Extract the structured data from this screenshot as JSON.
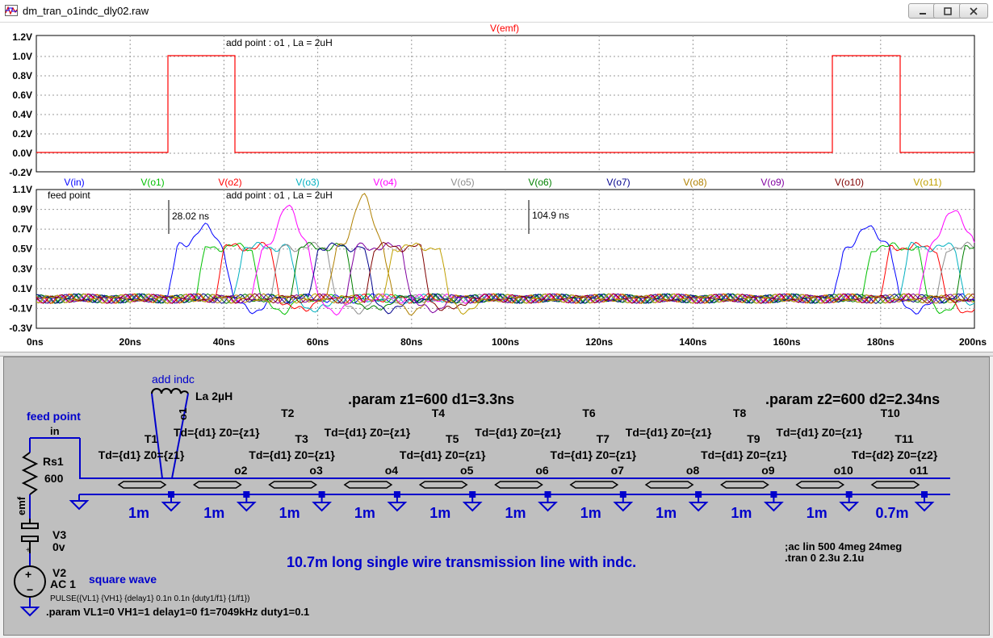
{
  "window": {
    "title": "dm_tran_o1indc_dly02.raw",
    "app_icon": "waveform-icon",
    "buttons": [
      "minimize-icon",
      "maximize-icon",
      "close-icon"
    ]
  },
  "plots": {
    "x_ticks": [
      "0ns",
      "20ns",
      "40ns",
      "60ns",
      "80ns",
      "100ns",
      "120ns",
      "140ns",
      "160ns",
      "180ns",
      "200ns"
    ],
    "top": {
      "trace_label": "V(emf)",
      "trace_color": "#ff0000",
      "y_ticks": [
        "1.2V",
        "1.0V",
        "0.8V",
        "0.6V",
        "0.4V",
        "0.2V",
        "0.0V",
        "-0.2V"
      ],
      "annotation": "add point : o1 , La = 2uH"
    },
    "bottom": {
      "y_ticks": [
        "1.1V",
        "0.9V",
        "0.7V",
        "0.5V",
        "0.3V",
        "0.1V",
        "-0.1V",
        "-0.3V"
      ],
      "annotation_left": "feed point",
      "annotation_mid": "add point : o1 , La = 2uH",
      "cursor1": "28.02 ns",
      "cursor2": "104.9 ns",
      "legend": [
        {
          "label": "V(in)",
          "color": "#0000ff"
        },
        {
          "label": "V(o1)",
          "color": "#00c000"
        },
        {
          "label": "V(o2)",
          "color": "#ff0000"
        },
        {
          "label": "V(o3)",
          "color": "#00b0c0"
        },
        {
          "label": "V(o4)",
          "color": "#ff00ff"
        },
        {
          "label": "V(o5)",
          "color": "#8c8c8c"
        },
        {
          "label": "V(o6)",
          "color": "#008000"
        },
        {
          "label": "V(o7)",
          "color": "#00008c"
        },
        {
          "label": "V(o8)",
          "color": "#b08000"
        },
        {
          "label": "V(o9)",
          "color": "#8000a0"
        },
        {
          "label": "V(o10)",
          "color": "#800000"
        },
        {
          "label": "V(o11)",
          "color": "#c0a000"
        }
      ]
    }
  },
  "schematic": {
    "add_indc": "add indc",
    "la": "La  2µH",
    "o1": "o1",
    "feed_point": "feed point",
    "in": "in",
    "rs1": "Rs1",
    "rs1_value": "600",
    "emf": "emf",
    "v3": "V3",
    "v3_value": "0v",
    "v2": "V2",
    "v2_value": "AC 1",
    "square_wave": "square wave",
    "pulse": "PULSE({VL1} {VH1} {delay1} 0.1n 0.1n {duty1/f1} {1/f1})",
    "param3": ".param VL1=0 VH1=1 delay1=0 f1=7049kHz duty1=0.1",
    "param1": ".param z1=600 d1=3.3ns",
    "param2": ".param z2=600 d2=2.34ns",
    "description": "10.7m long single wire transmission line with indc.",
    "ac_directive": ";ac lin 500 4meg 24meg",
    "tran_directive": ".tran 0 2.3u 2.1u",
    "lines": [
      {
        "name": "T1",
        "td": "Td={d1} Z0={z1}",
        "node": "",
        "len": "1m"
      },
      {
        "name": "T2",
        "td": "Td={d1} Z0={z1}",
        "node": "o2",
        "len": "1m"
      },
      {
        "name": "T3",
        "td": "Td={d1} Z0={z1}",
        "node": "o3",
        "len": "1m"
      },
      {
        "name": "T4",
        "td": "Td={d1} Z0={z1}",
        "node": "o4",
        "len": "1m"
      },
      {
        "name": "T5",
        "td": "Td={d1} Z0={z1}",
        "node": "o5",
        "len": "1m"
      },
      {
        "name": "T6",
        "td": "Td={d1} Z0={z1}",
        "node": "o6",
        "len": "1m"
      },
      {
        "name": "T7",
        "td": "Td={d1} Z0={z1}",
        "node": "o7",
        "len": "1m"
      },
      {
        "name": "T8",
        "td": "Td={d1} Z0={z1}",
        "node": "o8",
        "len": "1m"
      },
      {
        "name": "T9",
        "td": "Td={d1} Z0={z1}",
        "node": "o9",
        "len": "1m"
      },
      {
        "name": "T10",
        "td": "Td={d1} Z0={z1}",
        "node": "o10",
        "len": "1m"
      },
      {
        "name": "T11",
        "td": "Td={d2} Z0={z2}",
        "node": "o11",
        "len": "0.7m"
      }
    ]
  }
}
